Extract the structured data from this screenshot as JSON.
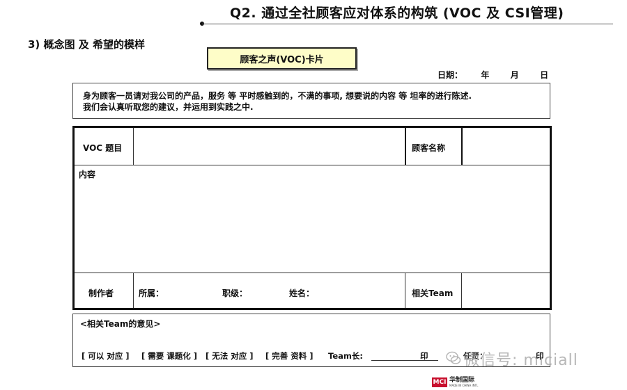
{
  "header": {
    "title": "Q2.   通过全社顾客应对体系的构筑 (VOC 及 CSI管理)"
  },
  "section": {
    "heading": "3) 概念图 及 希望的模样"
  },
  "card": {
    "title": "顾客之声(VOC)卡片",
    "date_label": "日期：",
    "year": "年",
    "month": "月",
    "day": "日"
  },
  "intro": {
    "line1": "身为顾客一员请对我公司的产品，服务 等 平时感触到的，不满的事项, 想要说的内容 等 坦率的进行陈述.",
    "line2": "我们会认真听取您的建议，并运用到实践之中."
  },
  "form": {
    "voc_topic_label": "VOC 题目",
    "customer_name_label": "顾客名称",
    "content_label": "内容",
    "maker_label": "制作者",
    "affiliation_label": "所属：",
    "rank_label": "职级：",
    "name_label": "姓名：",
    "related_team_label": "相关Team"
  },
  "opinion": {
    "title": "<相关Team的意见>",
    "options": [
      "[ 可以 对应 ]",
      "[ 需要 课题化 ]",
      "[ 无法 对应 ]",
      "[ 完善 资料 ]"
    ],
    "leader_label": "Team长:",
    "seal1": "印",
    "responsible_label": "任责：",
    "seal2": "印"
  },
  "watermark": {
    "text": "微信号: miciall",
    "icon": "wechat-icon"
  },
  "logo": {
    "mark": "MCI",
    "name": "华制国际",
    "sub": "MADE IN CHINA INTL"
  }
}
